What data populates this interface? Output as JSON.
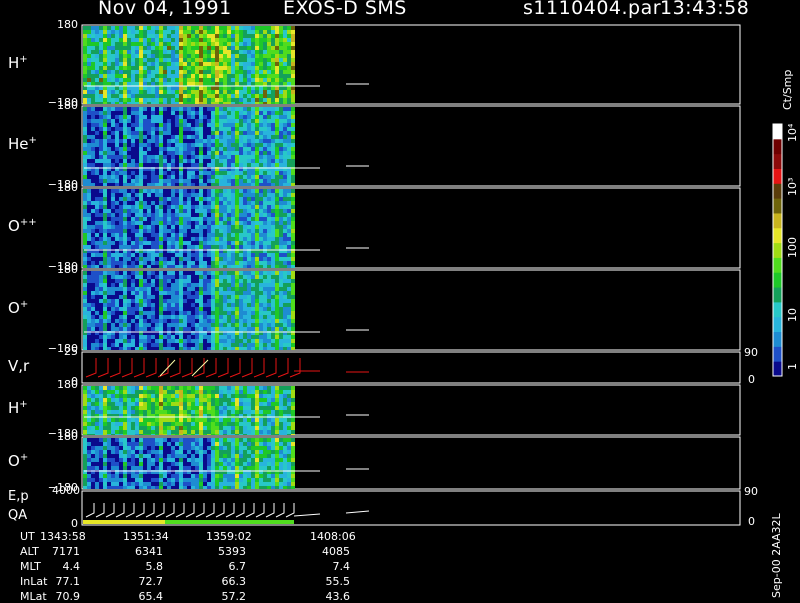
{
  "header": {
    "date": "Nov 04, 1991",
    "instrument": "EXOS-D SMS",
    "file": "s1110404.par",
    "time": "13:43:58"
  },
  "colorbar": {
    "unit": "Ct/Smp",
    "tick_labels": [
      "1",
      "10",
      "100",
      "10³",
      "10⁴"
    ],
    "colors": [
      "#0a0a8c",
      "#1e50c8",
      "#1e8cd2",
      "#28b4dc",
      "#28c8c8",
      "#14a05a",
      "#1ec828",
      "#50dc1e",
      "#a0dc14",
      "#e6e628",
      "#c8b41e",
      "#6e640a",
      "#5a3c0a",
      "#e61414",
      "#8c0a0a",
      "#6e0000",
      "#ffffff"
    ]
  },
  "version": "Sep-00 2AA32L",
  "panels": [
    {
      "label": "H",
      "sup": "+",
      "ytop": "180",
      "ybot": "−180"
    },
    {
      "label": "He",
      "sup": "+",
      "ytop": "180",
      "ybot": "−180"
    },
    {
      "label": "O",
      "sup": "++",
      "ytop": "180",
      "ybot": "−180"
    },
    {
      "label": "O",
      "sup": "+",
      "ytop": "180",
      "ybot": "−180"
    },
    {
      "label": "V,r",
      "sup": "",
      "ytop": "25",
      "ybot": "0",
      "rtop": "90",
      "rbot": "0"
    },
    {
      "label": "H",
      "sup": "+",
      "ytop": "180",
      "ybot": "−180"
    },
    {
      "label": "O",
      "sup": "+",
      "ytop": "180",
      "ybot": "−180"
    },
    {
      "label": "E,p",
      "sup": "",
      "label2": "QA",
      "ytop": "4000",
      "ybot": "0",
      "rtop": "90",
      "rbot": "0"
    }
  ],
  "axis": {
    "rows": [
      "UT",
      "ALT",
      "MLT",
      "InLat",
      "MLat"
    ],
    "columns": [
      [
        "1343:58",
        "7171",
        "4.4",
        "77.1",
        "70.9"
      ],
      [
        "1351:34",
        "6341",
        "5.8",
        "72.7",
        "65.4"
      ],
      [
        "1359:02",
        "5393",
        "6.7",
        "66.3",
        "57.2"
      ],
      [
        "1408:06",
        "4085",
        "7.4",
        "55.5",
        "43.6"
      ]
    ]
  },
  "chart_data": {
    "type": "heatmap",
    "title": "Nov 04, 1991   EXOS-D SMS   s1110404.par  13:43:58",
    "x": [
      "1343:58",
      "1351:34",
      "1359:02",
      "1408:06"
    ],
    "panels": [
      "H+",
      "He+",
      "O++",
      "O+",
      "V,r",
      "H+",
      "O+",
      "E,p QA"
    ],
    "color_scale": {
      "label": "Ct/Smp",
      "ticks": [
        "1",
        "10",
        "100",
        "10^3",
        "10^4"
      ],
      "log": true
    }
  }
}
